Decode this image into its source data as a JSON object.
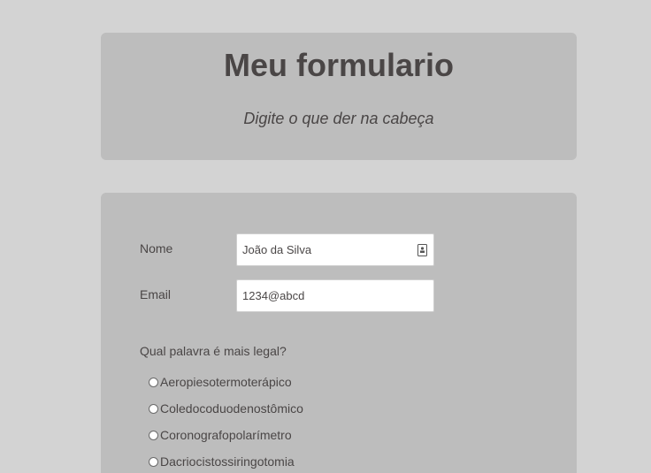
{
  "header": {
    "title": "Meu formulario",
    "subtitle": "Digite o que der na cabeça"
  },
  "form": {
    "name_label": "Nome",
    "name_value": "João da Silva",
    "email_label": "Email",
    "email_value": "1234@abcd",
    "question": "Qual palavra é mais legal?",
    "options": [
      {
        "label": "Aeropiesotermoterápico"
      },
      {
        "label": "Coledocoduodenostômico"
      },
      {
        "label": "Coronografopolarímetro"
      },
      {
        "label": "Dacriocistossiringotomia"
      }
    ]
  },
  "icons": {
    "name_field_icon": "contact-card-icon"
  }
}
